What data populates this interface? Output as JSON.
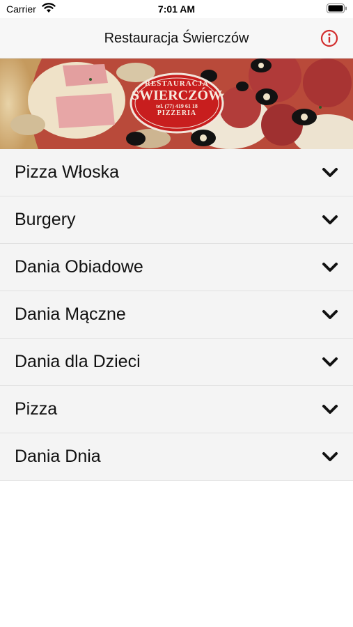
{
  "status_bar": {
    "carrier": "Carrier",
    "time": "7:01 AM"
  },
  "nav": {
    "title": "Restauracja Świerczów",
    "info_icon": "info-icon",
    "accent": "#d22d2d"
  },
  "banner": {
    "logo_top": "RESTAURACJA",
    "logo_name": "ŚWIERCZÓW",
    "logo_phone": "tel. (77) 419 61 18",
    "logo_bottom": "PIZZERIA",
    "logo_color": "#c81e1e"
  },
  "menu": {
    "items": [
      {
        "label": "Pizza Włoska"
      },
      {
        "label": "Burgery"
      },
      {
        "label": "Dania Obiadowe"
      },
      {
        "label": "Dania Mączne"
      },
      {
        "label": "Dania dla Dzieci"
      },
      {
        "label": "Pizza"
      },
      {
        "label": "Dania Dnia"
      }
    ],
    "chevron_icon": "chevron-down-icon"
  }
}
